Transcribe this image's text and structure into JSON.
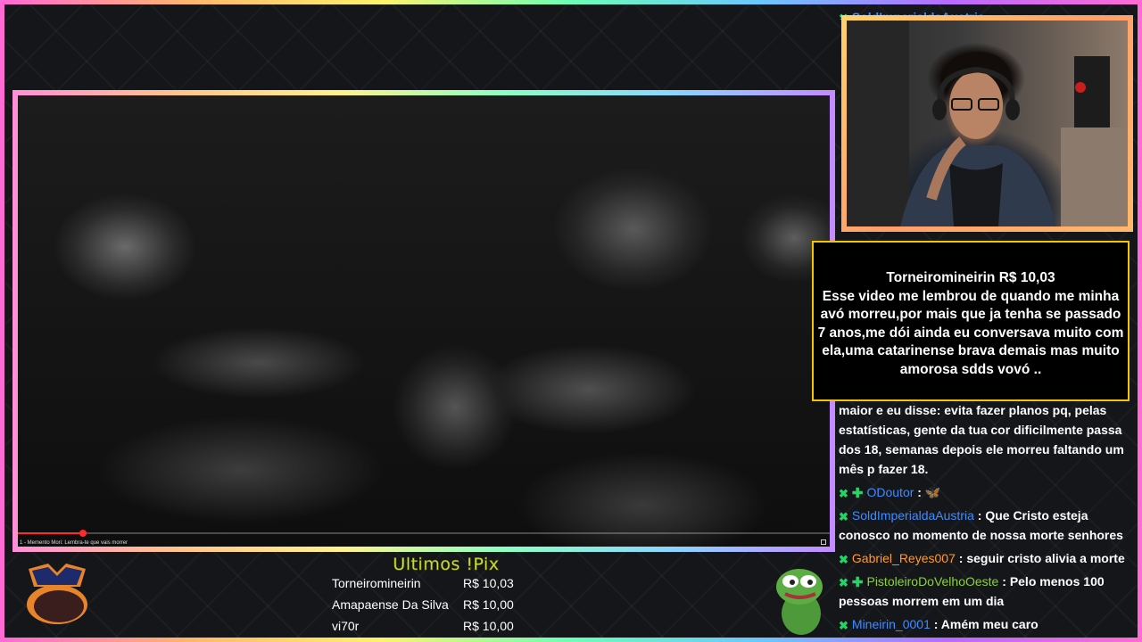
{
  "video": {
    "caption": "1 - Memento Mori: Lembra-te que vais morrer",
    "progress": 0.08
  },
  "donation": {
    "header": "Torneiromineirin R$ 10,03",
    "message": "Esse video me lembrou de quando me minha avó morreu,por mais que ja tenha se passado 7 anos,me dói ainda eu conversava muito com ela,uma catarinense brava demais mas muito amorosa sdds vovó .."
  },
  "chat": {
    "top_user": "SoldImperialdaAustria",
    "partial_message": "maior e eu disse: evita fazer planos pq, pelas estatísticas, gente da tua cor dificilmente passa dos 18, semanas depois ele morreu faltando um mês p fazer 18.",
    "messages": [
      {
        "user": "ODoutor",
        "color": "#3f8cff",
        "text": "🦋",
        "badges": [
          "k",
          "plus"
        ]
      },
      {
        "user": "SoldImperialdaAustria",
        "color": "#3f8cff",
        "text": "Que Cristo esteja conosco no momento de nossa morte senhores",
        "badges": [
          "k"
        ]
      },
      {
        "user": "Gabriel_Reyes007",
        "color": "#ff9b2f",
        "text": "seguir cristo alivia a morte",
        "badges": [
          "k"
        ]
      },
      {
        "user": "PistoleiroDoVelhoOeste",
        "color": "#8bd23a",
        "text": "Pelo menos 100 pessoas morrem em um dia",
        "badges": [
          "k",
          "plus"
        ]
      },
      {
        "user": "Mineirin_0001",
        "color": "#3f8cff",
        "text": "Amém meu caro",
        "badges": [
          "k"
        ]
      }
    ]
  },
  "pix": {
    "title": "Ultimos !Pix",
    "rows": [
      {
        "name": "Torneiromineirin",
        "value": "R$ 10,03"
      },
      {
        "name": "Amapaense Da Silva",
        "value": "R$ 10,00"
      },
      {
        "name": "vi70r",
        "value": "R$ 10,00"
      }
    ]
  }
}
